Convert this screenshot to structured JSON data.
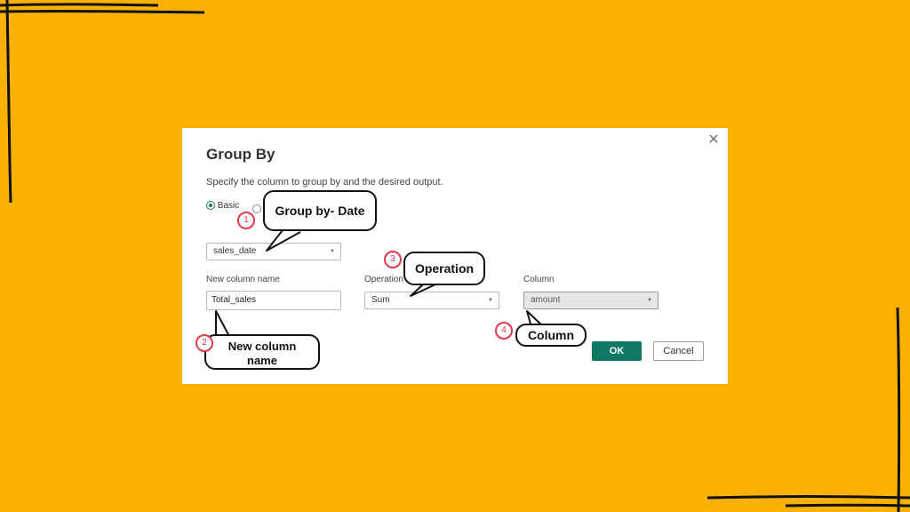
{
  "dialog": {
    "title": "Group By",
    "description": "Specify the column to group by and the desired output.",
    "radio_basic": "Basic",
    "group_by_value": "sales_date",
    "new_column_label": "New column name",
    "new_column_value": "Total_sales",
    "operation_label": "Operation",
    "operation_value": "Sum",
    "column_label": "Column",
    "column_value": "amount",
    "ok_label": "OK",
    "cancel_label": "Cancel",
    "close_glyph": "✕"
  },
  "annotations": {
    "c1": {
      "num": "1",
      "text": "Group by- Date"
    },
    "c2": {
      "num": "2",
      "text_line1": "New column",
      "text_line2": "name"
    },
    "c3": {
      "num": "3",
      "text": "Operation"
    },
    "c4": {
      "num": "4",
      "text": "Column"
    }
  },
  "colors": {
    "background": "#FBB102",
    "accent": "#117865",
    "badge": "#E03A4E"
  }
}
